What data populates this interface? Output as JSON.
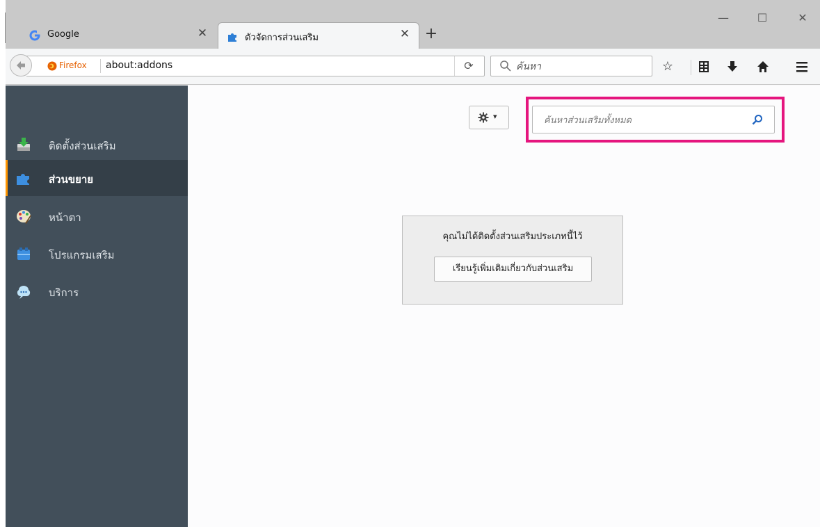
{
  "browser": {
    "tabs": [
      {
        "title": "Google",
        "icon": "google-g-icon",
        "active": false
      },
      {
        "title": "ตัวจัดการส่วนเสริม",
        "icon": "puzzle-piece-icon",
        "active": true
      }
    ],
    "new_tab_symbol": "+",
    "window_controls": {
      "minimize": "—",
      "maximize": "☐",
      "close": "✕"
    }
  },
  "navbar": {
    "identity_label": "Firefox",
    "url": "about:addons",
    "reload_symbol": "⟳",
    "search_placeholder": "ค้นหา"
  },
  "sidebar": {
    "items": [
      {
        "label": "ติดตั้งส่วนเสริม",
        "icon": "get-addons-icon",
        "selected": false
      },
      {
        "label": "ส่วนขยาย",
        "icon": "extensions-icon",
        "selected": true
      },
      {
        "label": "หน้าตา",
        "icon": "appearance-icon",
        "selected": false
      },
      {
        "label": "โปรแกรมเสริม",
        "icon": "plugins-icon",
        "selected": false
      },
      {
        "label": "บริการ",
        "icon": "services-icon",
        "selected": false
      }
    ]
  },
  "main": {
    "tools_caret": "▾",
    "addon_search_placeholder": "ค้นหาส่วนเสริมทั้งหมด",
    "empty_message": "คุณไม่ได้ติดตั้งส่วนเสริมประเภทนี้ไว้",
    "learn_more_label": "เรียนรู้เพิ่มเติมเกี่ยวกับส่วนเสริม"
  },
  "colors": {
    "highlight": "#e5157e",
    "sidebar_bg": "#424f5a",
    "selected_accent": "#ff9500"
  }
}
